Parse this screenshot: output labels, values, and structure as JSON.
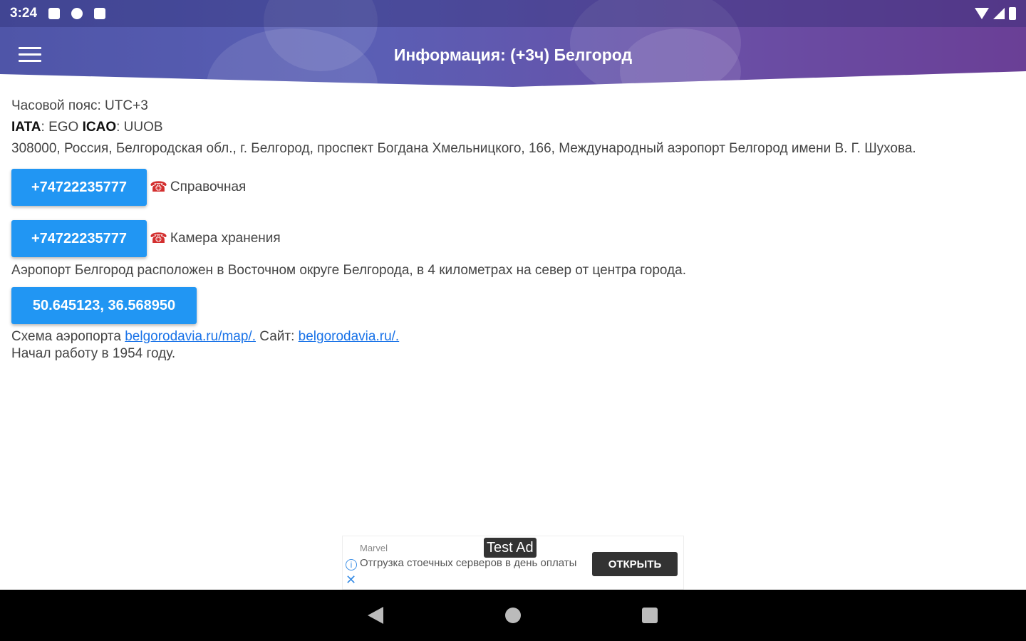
{
  "status_bar": {
    "time": "3:24"
  },
  "app_bar": {
    "title": "Информация: (+3ч) Белгород"
  },
  "info": {
    "timezone": "Часовой пояс: UTC+3",
    "iata_label": "IATA",
    "iata_value": ": EGO ",
    "icao_label": "ICAO",
    "icao_value": ": UUOB",
    "address": "308000, Россия, Белгородская обл., г. Белгород, проспект Богдана Хмельницкого, 166, Международный аэропорт Белгород имени В. Г. Шухова.",
    "phones": [
      {
        "number": "+74722235777",
        "icon": "☎",
        "label": "Справочная"
      },
      {
        "number": "+74722235777",
        "icon": "☎",
        "label": "Камера хранения"
      }
    ],
    "description": "Аэропорт Белгород расположен в Восточном округе Белгорода, в 4 километрах на север от центра города.",
    "coordinates": "50.645123, 36.568950",
    "map_label": "Схема аэропорта ",
    "map_link": "belgorodavia.ru/map/.",
    "site_label": " Сайт: ",
    "site_link": "belgorodavia.ru/.",
    "founded": "Начал работу в 1954 году."
  },
  "ad": {
    "badge": "Test Ad",
    "source": "Marvel",
    "text": "Отгрузка стоечных серверов в день оплаты",
    "cta": "ОТКРЫТЬ",
    "info_icon": "i",
    "close_icon": "✕"
  },
  "colors": {
    "header_start": "#4f55a8",
    "header_end": "#6a3f96",
    "button": "#2196f3",
    "link": "#1a73e8"
  }
}
